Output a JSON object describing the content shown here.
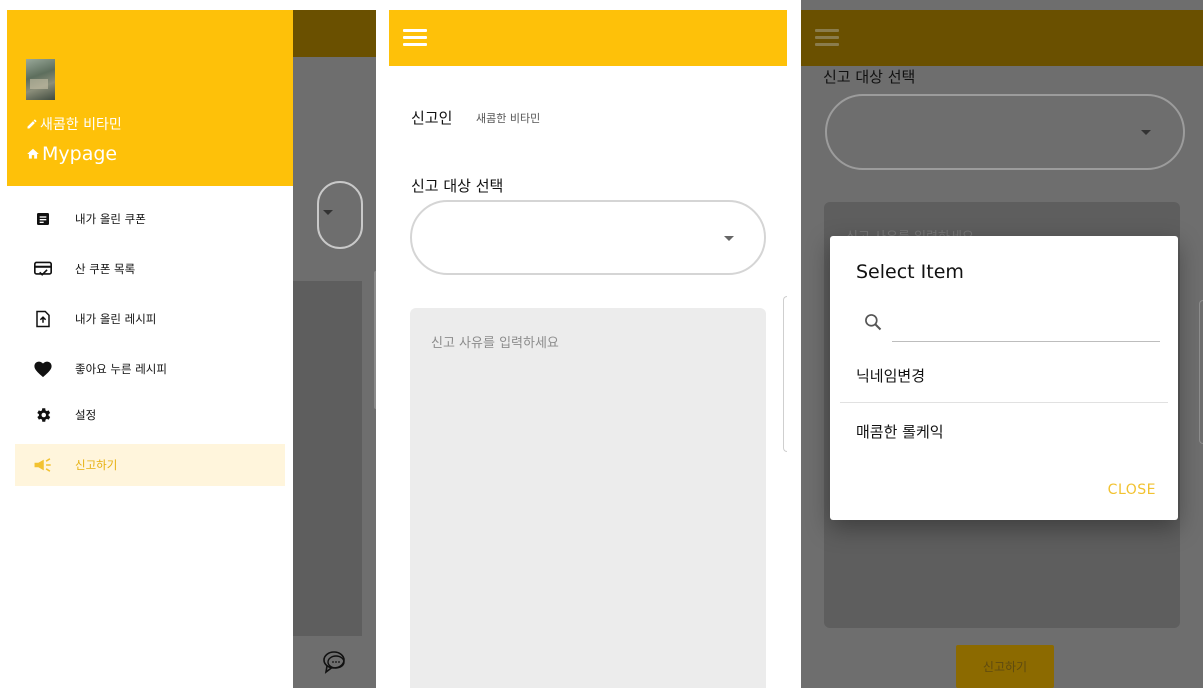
{
  "drawer": {
    "nickname": "새콤한 비타민",
    "mypage_label": "Mypage",
    "items": [
      {
        "label": "내가 올린 쿠폰",
        "icon": "document-icon"
      },
      {
        "label": "산 쿠폰 목록",
        "icon": "card-check-icon"
      },
      {
        "label": "내가 올린 레시피",
        "icon": "file-upload-icon"
      },
      {
        "label": "좋아요 누른 레시피",
        "icon": "heart-icon"
      },
      {
        "label": "설정",
        "icon": "gear-icon"
      },
      {
        "label": "신고하기",
        "icon": "megaphone-icon",
        "active": true
      }
    ]
  },
  "form": {
    "reporter_label": "신고인",
    "reporter_value": "새콤한 비타민",
    "target_label": "신고 대상 선택",
    "target_value": "",
    "reason_placeholder": "신고 사유를 입력하세요"
  },
  "dialog_screen": {
    "target_label": "신고 대상 선택",
    "reason_placeholder_partial": "신고 사유를 입력하세요",
    "submit_label": "신고하기",
    "dialog": {
      "title": "Select Item",
      "search_value": "",
      "options": [
        "닉네임변경",
        "매콤한 롤케익"
      ],
      "close_label": "CLOSE"
    }
  },
  "colors": {
    "primary": "#fec109",
    "primary_dimmed": "#6a5000",
    "active_item_bg": "#fff5dc",
    "accent_text": "#f2c230"
  }
}
